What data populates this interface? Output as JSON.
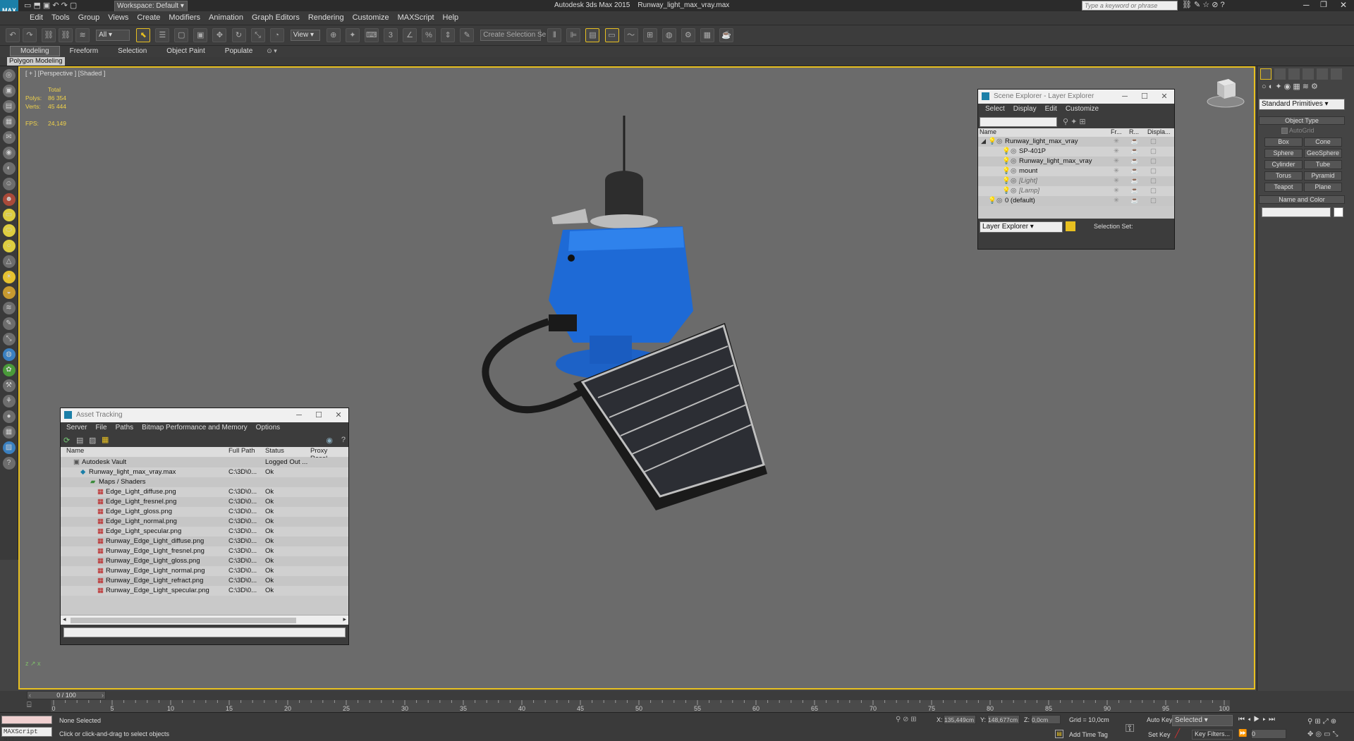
{
  "titlebar": {
    "app": "Autodesk 3ds Max  2015",
    "file": "Runway_light_max_vray.max",
    "workspace": "Workspace: Default",
    "search_placeholder": "Type a keyword or phrase"
  },
  "menu": [
    "Edit",
    "Tools",
    "Group",
    "Views",
    "Create",
    "Modifiers",
    "Animation",
    "Graph Editors",
    "Rendering",
    "Customize",
    "MAXScript",
    "Help"
  ],
  "toolbar": {
    "filter": "All",
    "refcoord": "View",
    "selection_set": "Create Selection Se"
  },
  "ribbon": {
    "tabs": [
      "Modeling",
      "Freeform",
      "Selection",
      "Object Paint",
      "Populate"
    ],
    "sub": "Polygon Modeling"
  },
  "viewport": {
    "label": "[ + ] [Perspective ] [Shaded ]",
    "stats": {
      "total": "Total",
      "polys_label": "Polys:",
      "polys": "86 354",
      "verts_label": "Verts:",
      "verts": "45 444",
      "fps_label": "FPS:",
      "fps": "24,149"
    }
  },
  "scene_explorer": {
    "title": "Scene Explorer - Layer Explorer",
    "menu": [
      "Select",
      "Display",
      "Edit",
      "Customize"
    ],
    "columns": [
      "Name",
      "Fr...",
      "R...",
      "Displa..."
    ],
    "rows": [
      {
        "name": "Runway_light_max_vray",
        "indent": 0
      },
      {
        "name": "SP-401P",
        "indent": 1
      },
      {
        "name": "Runway_light_max_vray",
        "indent": 1
      },
      {
        "name": "mount",
        "indent": 1
      },
      {
        "name": "[Light]",
        "indent": 1
      },
      {
        "name": "[Lamp]",
        "indent": 1
      },
      {
        "name": "0 (default)",
        "indent": 0
      }
    ],
    "footer_select": "Layer Explorer",
    "footer_label": "Selection Set:"
  },
  "asset_tracking": {
    "title": "Asset Tracking",
    "menu": [
      "Server",
      "File",
      "Paths",
      "Bitmap Performance and Memory",
      "Options"
    ],
    "columns": [
      "Name",
      "Full Path",
      "Status",
      "Proxy Resol..."
    ],
    "rows": [
      {
        "name": "Autodesk Vault",
        "path": "",
        "status": "Logged Out ...",
        "level": 1
      },
      {
        "name": "Runway_light_max_vray.max",
        "path": "C:\\3D\\0...",
        "status": "Ok",
        "level": 2
      },
      {
        "name": "Maps / Shaders",
        "path": "",
        "status": "",
        "level": 3
      },
      {
        "name": "Edge_Light_diffuse.png",
        "path": "C:\\3D\\0...",
        "status": "Ok",
        "level": 4
      },
      {
        "name": "Edge_Light_fresnel.png",
        "path": "C:\\3D\\0...",
        "status": "Ok",
        "level": 4
      },
      {
        "name": "Edge_Light_gloss.png",
        "path": "C:\\3D\\0...",
        "status": "Ok",
        "level": 4
      },
      {
        "name": "Edge_Light_normal.png",
        "path": "C:\\3D\\0...",
        "status": "Ok",
        "level": 4
      },
      {
        "name": "Edge_Light_specular.png",
        "path": "C:\\3D\\0...",
        "status": "Ok",
        "level": 4
      },
      {
        "name": "Runway_Edge_Light_diffuse.png",
        "path": "C:\\3D\\0...",
        "status": "Ok",
        "level": 4
      },
      {
        "name": "Runway_Edge_Light_fresnel.png",
        "path": "C:\\3D\\0...",
        "status": "Ok",
        "level": 4
      },
      {
        "name": "Runway_Edge_Light_gloss.png",
        "path": "C:\\3D\\0...",
        "status": "Ok",
        "level": 4
      },
      {
        "name": "Runway_Edge_Light_normal.png",
        "path": "C:\\3D\\0...",
        "status": "Ok",
        "level": 4
      },
      {
        "name": "Runway_Edge_Light_refract.png",
        "path": "C:\\3D\\0...",
        "status": "Ok",
        "level": 4
      },
      {
        "name": "Runway_Edge_Light_specular.png",
        "path": "C:\\3D\\0...",
        "status": "Ok",
        "level": 4
      }
    ]
  },
  "command_panel": {
    "category": "Standard Primitives",
    "object_type_label": "Object Type",
    "autogrid": "AutoGrid",
    "buttons": [
      "Box",
      "Cone",
      "Sphere",
      "GeoSphere",
      "Cylinder",
      "Tube",
      "Torus",
      "Pyramid",
      "Teapot",
      "Plane"
    ],
    "name_color_label": "Name and Color"
  },
  "timeline": {
    "frame": "0 / 100",
    "ticks": [
      "0",
      "5",
      "10",
      "15",
      "20",
      "25",
      "30",
      "35",
      "40",
      "45",
      "50",
      "55",
      "60",
      "65",
      "70",
      "75",
      "80",
      "85",
      "90",
      "95",
      "100"
    ]
  },
  "status": {
    "selection": "None Selected",
    "prompt": "Click or click-and-drag to select objects",
    "maxscript": "MAXScript Mi:",
    "x_label": "X:",
    "x": "135,449cm",
    "y_label": "Y:",
    "y": "148,677cm",
    "z_label": "Z:",
    "z": "0,0cm",
    "grid": "Grid = 10,0cm",
    "add_time_tag": "Add Time Tag",
    "auto_key": "Auto Key",
    "set_key": "Set Key",
    "key_mode": "Selected",
    "key_filters": "Key Filters...",
    "frame_input": "0"
  },
  "colors": {
    "accent": "#e8c020",
    "viewport_bg": "#6b6b6b",
    "light_body": "#1e6ad6",
    "panel": "#2a2a2e"
  }
}
